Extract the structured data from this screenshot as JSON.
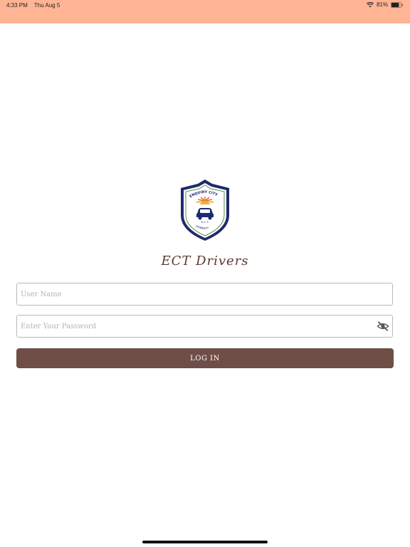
{
  "status_bar": {
    "time": "4:33 PM",
    "date": "Thu Aug 5",
    "battery": "81%",
    "color": "#ffb494"
  },
  "logo": {
    "top_text": "ENQUIRY CITY",
    "center_text": "E.C.T.",
    "bottom_text": "HONESTY"
  },
  "app": {
    "title": "ECT Drivers"
  },
  "form": {
    "username_placeholder": "User Name",
    "password_placeholder": "Enter Your Password",
    "password_toggle_icon": "eye-slash-icon",
    "login_label": "LOG IN",
    "login_color": "#6e4e47"
  }
}
